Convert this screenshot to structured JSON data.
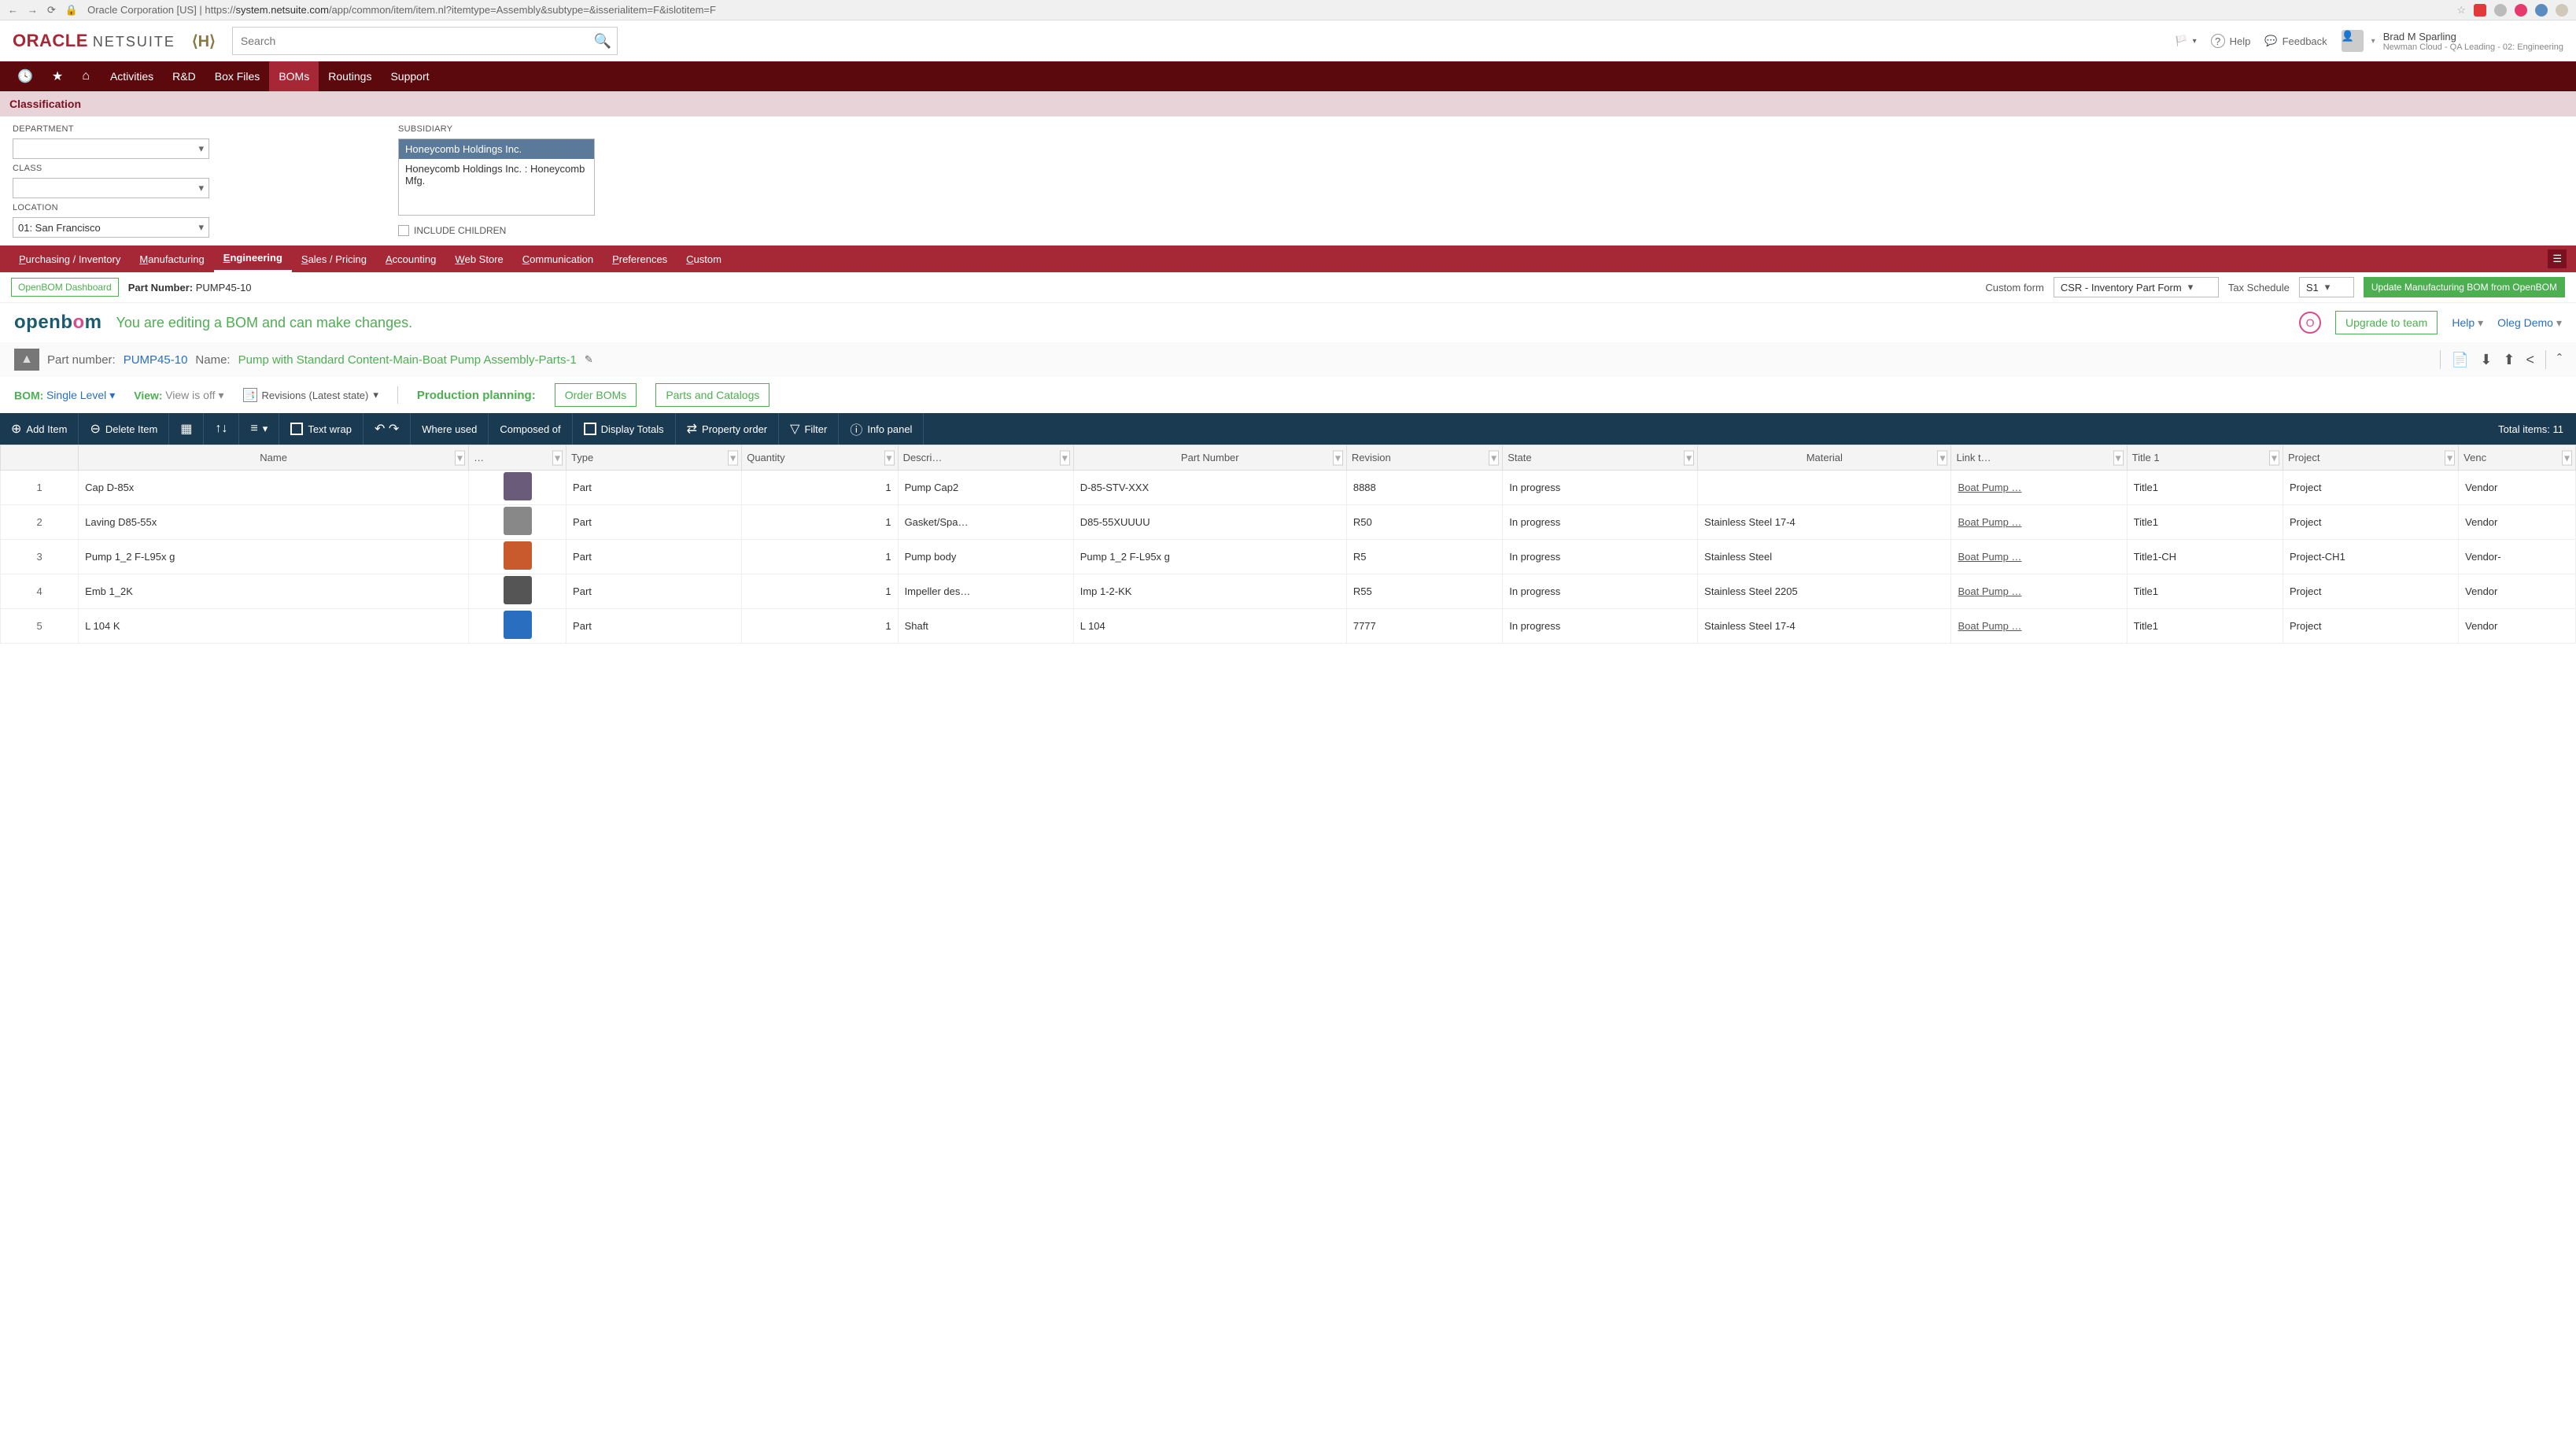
{
  "browser": {
    "url_prefix": "Oracle Corporation [US] | https://",
    "url_bold": "system.netsuite.com",
    "url_rest": "/app/common/item/item.nl?itemtype=Assembly&subtype=&isserialitem=F&islotitem=F"
  },
  "header": {
    "logo_oracle": "ORACLE",
    "logo_netsuite": "NETSUITE",
    "search_placeholder": "Search",
    "help": "Help",
    "feedback": "Feedback",
    "user_name": "Brad M Sparling",
    "user_role": "Newman Cloud - QA Leading - 02: Engineering"
  },
  "nav": {
    "items": [
      "Activities",
      "R&D",
      "Box Files",
      "BOMs",
      "Routings",
      "Support"
    ],
    "active": "BOMs"
  },
  "classification": {
    "title": "Classification",
    "department_label": "DEPARTMENT",
    "department_value": "",
    "class_label": "CLASS",
    "class_value": "",
    "location_label": "LOCATION",
    "location_value": "01: San Francisco",
    "subsidiary_label": "SUBSIDIARY",
    "subsidiary_items": [
      {
        "text": "Honeycomb Holdings Inc.",
        "selected": true
      },
      {
        "text": "Honeycomb Holdings Inc. : Honeycomb Mfg.",
        "selected": false
      }
    ],
    "include_children": "INCLUDE CHILDREN"
  },
  "subtabs": {
    "items": [
      "Purchasing / Inventory",
      "Manufacturing",
      "Engineering",
      "Sales / Pricing",
      "Accounting",
      "Web Store",
      "Communication",
      "Preferences",
      "Custom"
    ],
    "active": "Engineering"
  },
  "ob_bar": {
    "dashboard_btn": "OpenBOM Dashboard",
    "part_number_label": "Part Number:",
    "part_number_value": "PUMP45-10",
    "custom_form_label": "Custom form",
    "custom_form_value": "CSR - Inventory Part Form",
    "tax_schedule_label": "Tax Schedule",
    "tax_schedule_value": "S1",
    "update_btn": "Update Manufacturing BOM from OpenBOM"
  },
  "ob_header": {
    "logo_open": "open",
    "logo_b": "b",
    "logo_o": "o",
    "logo_m": "m",
    "edit_msg": "You are editing a BOM and can make changes.",
    "status_icon": "O",
    "upgrade": "Upgrade to team",
    "help": "Help",
    "user": "Oleg Demo"
  },
  "bom_title": {
    "pn_label": "Part number:",
    "pn_value": "PUMP45-10",
    "name_label": "Name:",
    "name_value": "Pump with Standard Content-Main-Boat Pump Assembly-Parts-1"
  },
  "bom_controls": {
    "bom_label": "BOM:",
    "bom_value": "Single Level",
    "view_label": "View:",
    "view_value": "View is off",
    "revisions": "Revisions (Latest state)",
    "pp_label": "Production planning:",
    "order_boms": "Order BOMs",
    "parts_catalogs": "Parts and Catalogs"
  },
  "toolbar": {
    "add_item": "Add Item",
    "delete_item": "Delete Item",
    "text_wrap": "Text wrap",
    "where_used": "Where used",
    "composed_of": "Composed of",
    "display_totals": "Display Totals",
    "property_order": "Property order",
    "filter": "Filter",
    "info_panel": "Info panel",
    "total_items": "Total items: 11"
  },
  "table": {
    "headers": [
      "",
      "Name",
      "…",
      "Type",
      "Quantity",
      "Descri…",
      "Part Number",
      "Revision",
      "State",
      "Material",
      "Link t…",
      "Title 1",
      "Project",
      "Venc"
    ],
    "rows": [
      {
        "idx": "1",
        "name": "Cap D-85x",
        "icon": "#6b5b7a",
        "type": "Part",
        "qty": "1",
        "desc": "Pump Cap2",
        "pn": "D-85-STV-XXX",
        "rev": "8888",
        "state": "In progress",
        "mat": "",
        "link": "Boat Pump …",
        "title": "Title1",
        "project": "Project",
        "vendor": "Vendor"
      },
      {
        "idx": "2",
        "name": "Laving D85-55x",
        "icon": "#888",
        "type": "Part",
        "qty": "1",
        "desc": "Gasket/Spa…",
        "pn": "D85-55XUUUU",
        "rev": "R50",
        "state": "In progress",
        "mat": "Stainless Steel 17-4",
        "link": "Boat Pump …",
        "title": "Title1",
        "project": "Project",
        "vendor": "Vendor"
      },
      {
        "idx": "3",
        "name": "Pump 1_2 F-L95x g",
        "icon": "#c85a2e",
        "type": "Part",
        "qty": "1",
        "desc": "Pump body",
        "pn": "Pump 1_2 F-L95x g",
        "rev": "R5",
        "state": "In progress",
        "mat": "Stainless Steel",
        "link": "Boat Pump …",
        "title": "Title1-CH",
        "project": "Project-CH1",
        "vendor": "Vendor-"
      },
      {
        "idx": "4",
        "name": "Emb 1_2K",
        "icon": "#555",
        "type": "Part",
        "qty": "1",
        "desc": "Impeller des…",
        "pn": "Imp 1-2-KK",
        "rev": "R55",
        "state": "In progress",
        "mat": "Stainless Steel 2205",
        "link": "Boat Pump …",
        "title": "Title1",
        "project": "Project",
        "vendor": "Vendor"
      },
      {
        "idx": "5",
        "name": "L 104 K",
        "icon": "#2a6fbf",
        "type": "Part",
        "qty": "1",
        "desc": "Shaft",
        "pn": "L 104",
        "rev": "7777",
        "state": "In progress",
        "mat": "Stainless Steel 17-4",
        "link": "Boat Pump …",
        "title": "Title1",
        "project": "Project",
        "vendor": "Vendor"
      }
    ]
  }
}
